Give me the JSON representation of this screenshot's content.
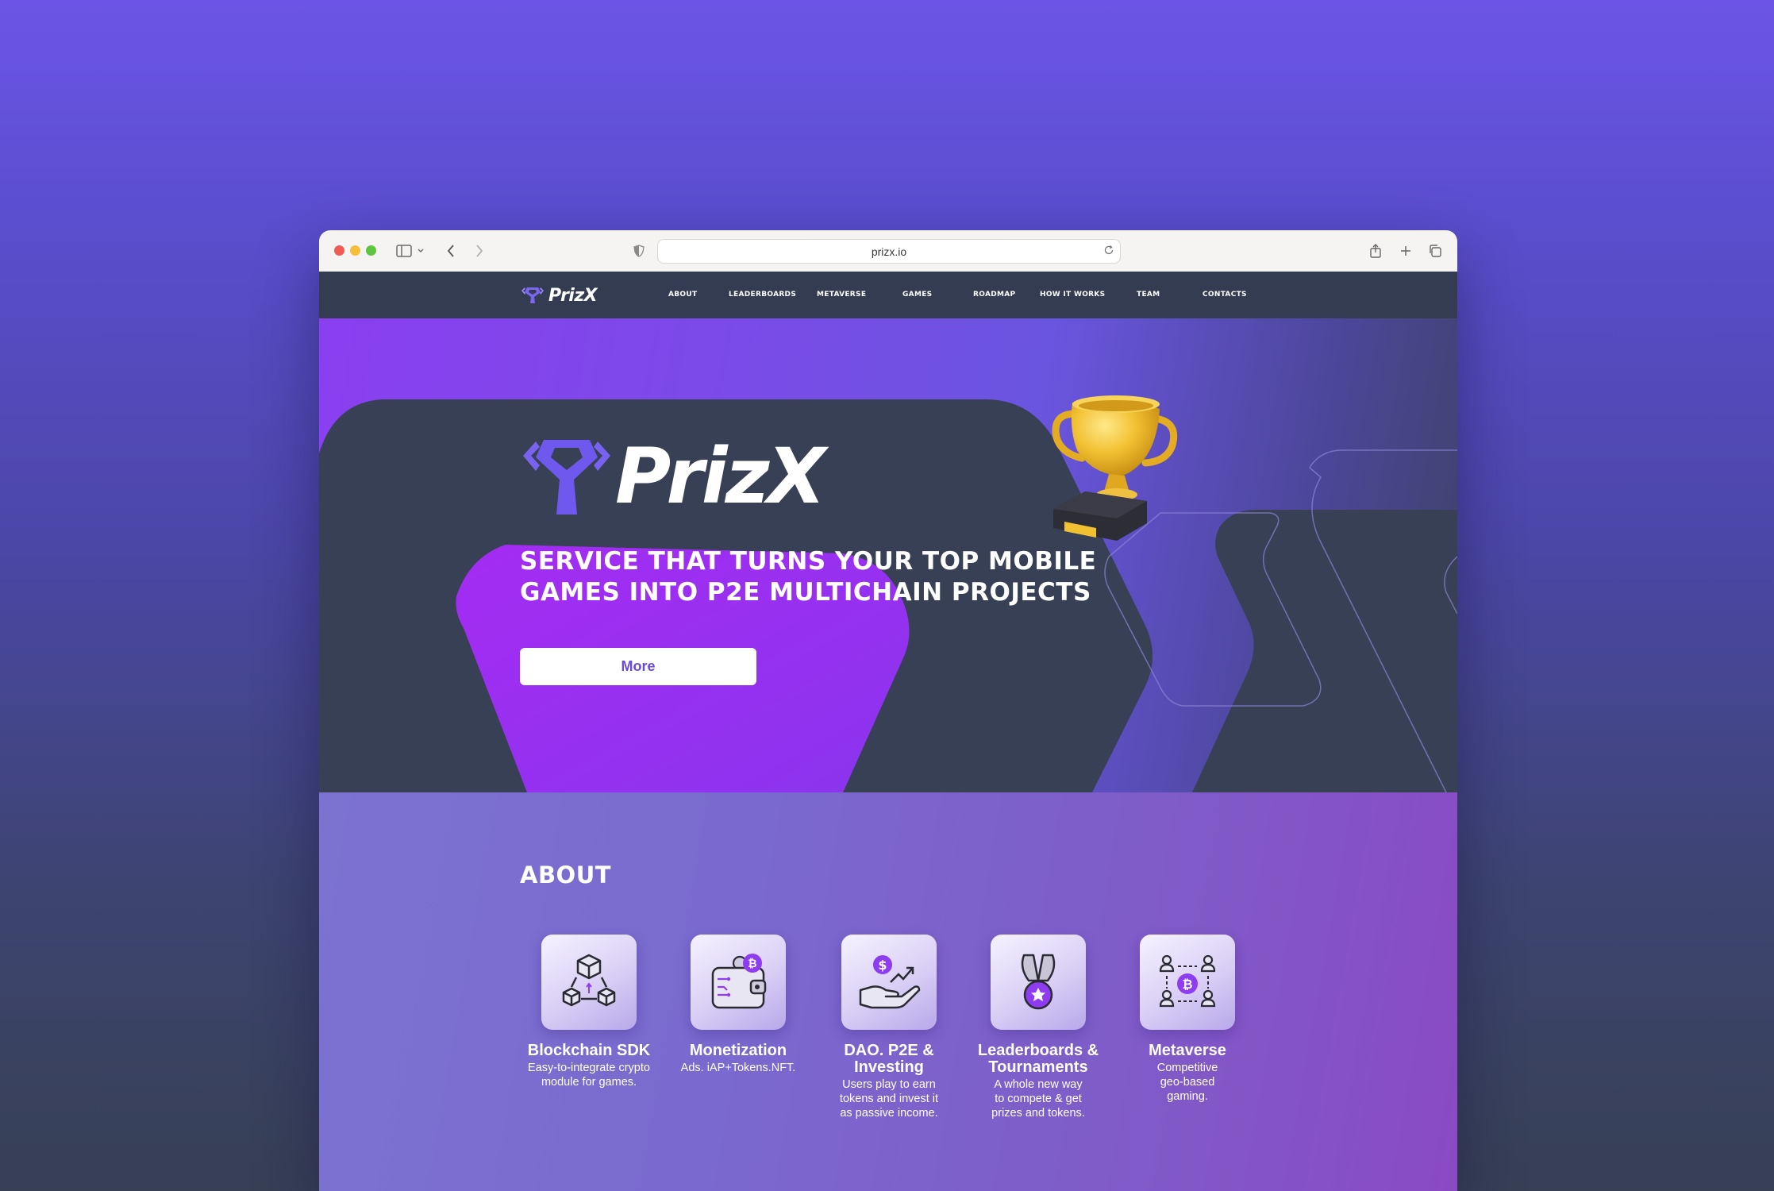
{
  "browser": {
    "url": "prizx.io"
  },
  "nav": {
    "logo_text": "PrizX",
    "items": [
      "ABOUT",
      "LEADERBOARDS",
      "METAVERSE",
      "GAMES",
      "ROADMAP",
      "HOW IT WORKS",
      "TEAM",
      "CONTACTS"
    ]
  },
  "hero": {
    "logo_text": "PrizX",
    "tagline_line1": "SERVICE THAT TURNS YOUR TOP MOBILE",
    "tagline_line2": "GAMES INTO P2E MULTICHAIN PROJECTS",
    "button_label": "More"
  },
  "about": {
    "title": "ABOUT",
    "features": [
      {
        "icon": "blockchain-icon",
        "title": "Blockchain SDK",
        "desc": [
          "Easy-to-integrate crypto",
          "module for games."
        ]
      },
      {
        "icon": "wallet-icon",
        "title": "Monetization",
        "desc": [
          "Ads. iAP+Tokens.NFT."
        ]
      },
      {
        "icon": "investing-hand-icon",
        "title": "DAO. P2E & Investing",
        "desc": [
          "Users play to earn",
          "tokens and invest it",
          "as passive income."
        ]
      },
      {
        "icon": "medal-icon",
        "title": "Leaderboards & Tournaments",
        "desc": [
          "A whole new way",
          "to compete & get",
          "prizes and tokens."
        ]
      },
      {
        "icon": "network-icon",
        "title": "Metaverse",
        "desc": [
          "Competitive",
          "geo-based",
          "gaming."
        ]
      }
    ]
  },
  "colors": {
    "accent": "#8a3ff0",
    "nav_bg": "#343c51",
    "button_text": "#6a4ad8"
  }
}
